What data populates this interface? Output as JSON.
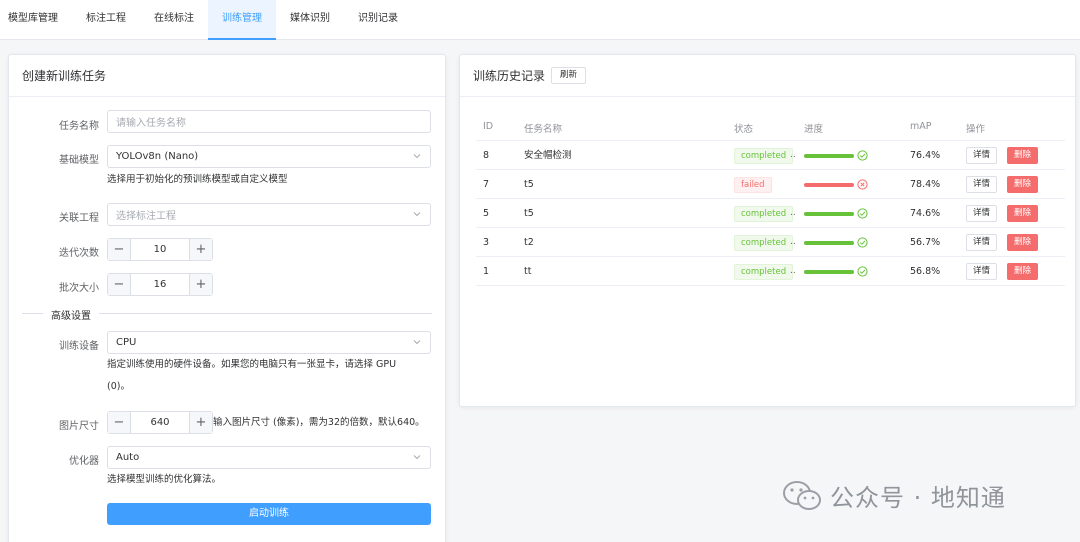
{
  "nav": {
    "tabs": [
      {
        "label": "模型库管理",
        "active": false
      },
      {
        "label": "标注工程",
        "active": false
      },
      {
        "label": "在线标注",
        "active": false
      },
      {
        "label": "训练管理",
        "active": true
      },
      {
        "label": "媒体识别",
        "active": false
      },
      {
        "label": "识别记录",
        "active": false
      }
    ]
  },
  "create": {
    "title": "创建新训练任务",
    "task_name_label": "任务名称",
    "task_name_placeholder": "请输入任务名称",
    "base_model_label": "基础模型",
    "base_model_value": "YOLOv8n (Nano)",
    "base_model_hint": "选择用于初始化的预训练模型或自定义模型",
    "project_label": "关联工程",
    "project_placeholder": "选择标注工程",
    "epochs_label": "迭代次数",
    "epochs_value": "10",
    "batch_label": "批次大小",
    "batch_value": "16",
    "advanced_label": "高级设置",
    "device_label": "训练设备",
    "device_value": "CPU",
    "device_hint_line1": "指定训练使用的硬件设备。如果您的电脑只有一张显卡，请选择 GPU",
    "device_hint_line2": "(0)。",
    "imgsize_label": "图片尺寸",
    "imgsize_value": "640",
    "imgsize_hint": "输入图片尺寸 (像素)，需为32的倍数，默认640。",
    "optimizer_label": "优化器",
    "optimizer_value": "Auto",
    "optimizer_hint": "选择模型训练的优化算法。",
    "start_button": "启动训练"
  },
  "history": {
    "title": "训练历史记录",
    "refresh_label": "刷新",
    "columns": [
      "ID",
      "任务名称",
      "状态",
      "进度",
      "mAP",
      "操作"
    ],
    "rows": [
      {
        "id": "8",
        "name": "安全帽检测",
        "status": "completed",
        "status_type": "success",
        "progress": 1.0,
        "map": "76.4%",
        "detail": "详情",
        "delete": "删除"
      },
      {
        "id": "7",
        "name": "t5",
        "status": "failed",
        "status_type": "danger",
        "progress": 1.0,
        "map": "78.4%",
        "detail": "详情",
        "delete": "删除"
      },
      {
        "id": "5",
        "name": "t5",
        "status": "completed",
        "status_type": "success",
        "progress": 1.0,
        "map": "74.6%",
        "detail": "详情",
        "delete": "删除"
      },
      {
        "id": "3",
        "name": "t2",
        "status": "completed",
        "status_type": "success",
        "progress": 1.0,
        "map": "56.7%",
        "detail": "详情",
        "delete": "删除"
      },
      {
        "id": "1",
        "name": "tt",
        "status": "completed",
        "status_type": "success",
        "progress": 1.0,
        "map": "56.8%",
        "detail": "详情",
        "delete": "删除"
      }
    ]
  },
  "watermark": {
    "text": "公众号 · 地知通",
    "icon": "wechat-icon"
  },
  "colors": {
    "primary": "#409eff",
    "success": "#67c23a",
    "danger": "#f56c6c"
  }
}
